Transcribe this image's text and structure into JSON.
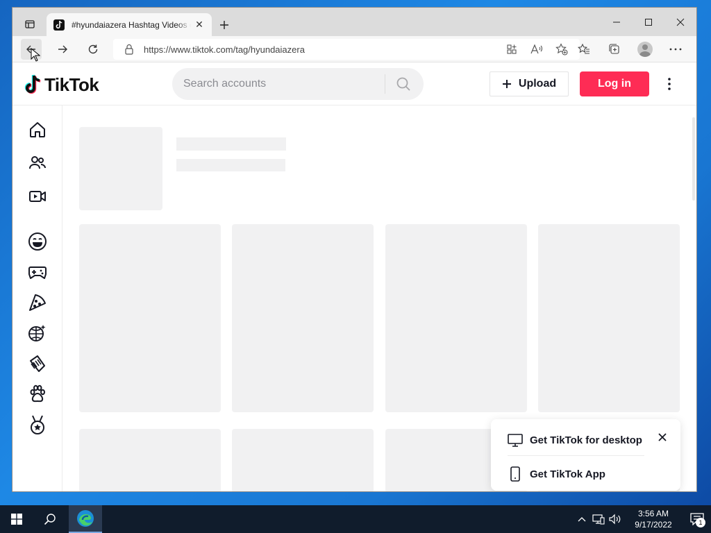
{
  "browser": {
    "tab": {
      "title": "#hyundaiazera Hashtag Videos on TikTok",
      "close": "✕"
    },
    "new_tab": "+",
    "address": {
      "url": "https://www.tiktok.com/tag/hyundaiazera"
    }
  },
  "site": {
    "logo_text": "TikTok",
    "search": {
      "placeholder": "Search accounts"
    },
    "upload_label": "Upload",
    "login_label": "Log in",
    "sidebar": [
      {
        "icon": "home-icon"
      },
      {
        "icon": "following-icon"
      },
      {
        "icon": "live-icon"
      },
      {
        "icon": "comedy-icon"
      },
      {
        "icon": "gaming-icon"
      },
      {
        "icon": "food-icon"
      },
      {
        "icon": "dance-icon"
      },
      {
        "icon": "beauty-icon"
      },
      {
        "icon": "animals-icon"
      },
      {
        "icon": "sports-icon"
      }
    ],
    "promo": {
      "desktop_label": "Get TikTok for desktop",
      "app_label": "Get TikTok App"
    }
  },
  "taskbar": {
    "time": "3:56 AM",
    "date": "9/17/2022",
    "notification_count": "1"
  },
  "colors": {
    "accent": "#fe2c55",
    "skeleton": "#f1f1f2",
    "taskbar": "#101c2c"
  }
}
